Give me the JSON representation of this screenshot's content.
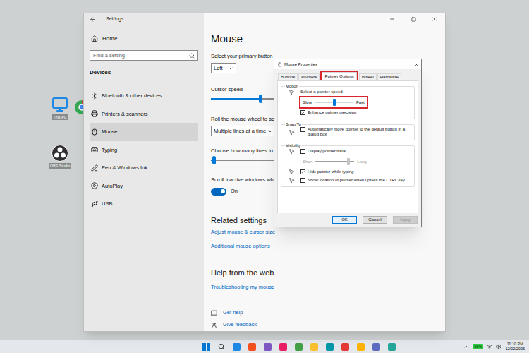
{
  "desktop": {
    "icons": [
      {
        "label": "This PC"
      },
      {
        "label": "OBS Studio"
      }
    ]
  },
  "settings": {
    "title": "Settings",
    "home": "Home",
    "search": {
      "placeholder": "Find a setting"
    },
    "section": "Devices",
    "nav": [
      {
        "label": "Bluetooth & other devices",
        "selected": false
      },
      {
        "label": "Printers & scanners",
        "selected": false
      },
      {
        "label": "Mouse",
        "selected": true
      },
      {
        "label": "Typing",
        "selected": false
      },
      {
        "label": "Pen & Windows Ink",
        "selected": false
      },
      {
        "label": "AutoPlay",
        "selected": false
      },
      {
        "label": "USB",
        "selected": false
      }
    ],
    "page": {
      "title": "Mouse",
      "primary_button": {
        "label": "Select your primary button",
        "value": "Left"
      },
      "cursor_speed": {
        "label": "Cursor speed",
        "level": 0.5
      },
      "wheel": {
        "label": "Roll the mouse wheel to sc",
        "value": "Multiple lines at a time"
      },
      "lines": {
        "label": "Choose how many lines to sc",
        "level": 0.03
      },
      "scroll_inactive": {
        "label": "Scroll inactive windows wh",
        "on": true,
        "state": "On"
      },
      "related": {
        "title": "Related settings",
        "links": [
          "Adjust mouse & cursor size",
          "Additional mouse options"
        ]
      },
      "help": {
        "title": "Help from the web",
        "links": [
          "Troubleshooting my mouse"
        ]
      },
      "footer": [
        {
          "label": "Get help"
        },
        {
          "label": "Give feedback"
        }
      ]
    }
  },
  "dialog": {
    "title": "Mouse Properties",
    "tabs": [
      {
        "label": "Buttons",
        "selected": false,
        "annotated": false
      },
      {
        "label": "Pointers",
        "selected": false,
        "annotated": false
      },
      {
        "label": "Pointer Options",
        "selected": true,
        "annotated": true
      },
      {
        "label": "Wheel",
        "selected": false,
        "annotated": false
      },
      {
        "label": "Hardware",
        "selected": false,
        "annotated": false
      }
    ],
    "groups": [
      {
        "title": "Motion",
        "rows": [
          {
            "kind": "label",
            "label": "Select a pointer speed:"
          },
          {
            "kind": "slider",
            "min_label": "Slow",
            "max_label": "Fast",
            "level": 0.5,
            "disabled": false,
            "annotated": true
          },
          {
            "kind": "checkbox",
            "label": "Enhance pointer precision",
            "checked": true
          }
        ]
      },
      {
        "title": "Snap To",
        "rows": [
          {
            "kind": "checkbox",
            "label": "Automatically move pointer to the default button in a dialog box",
            "checked": false
          }
        ]
      },
      {
        "title": "Visibility",
        "rows": [
          {
            "kind": "checkbox",
            "label": "Display pointer trails",
            "checked": false
          },
          {
            "kind": "slider",
            "min_label": "Short",
            "max_label": "Long",
            "level": 0.85,
            "disabled": true,
            "annotated": false
          },
          {
            "kind": "checkbox",
            "label": "Hide pointer while typing",
            "checked": true
          },
          {
            "kind": "checkbox",
            "label": "Show location of pointer when I press the CTRL key",
            "checked": false
          }
        ]
      }
    ],
    "buttons": [
      {
        "label": "OK",
        "default": true,
        "disabled": false
      },
      {
        "label": "Cancel",
        "default": false,
        "disabled": false
      },
      {
        "label": "Apply",
        "default": false,
        "disabled": true
      }
    ]
  },
  "taskbar": {
    "apps": [
      {
        "color": "#1e88e5"
      },
      {
        "color": "#f4511e"
      },
      {
        "color": "#7e57c2"
      },
      {
        "color": "#e91e63"
      },
      {
        "color": "#43a047"
      },
      {
        "color": "#fbc02d"
      },
      {
        "color": "#0097a7"
      },
      {
        "color": "#e53935"
      },
      {
        "color": "#ffb300"
      },
      {
        "color": "#5c6bc0"
      },
      {
        "color": "#26a69a"
      }
    ],
    "battery": "56%",
    "time": "11:10 PM",
    "date": "12/02/2026"
  }
}
